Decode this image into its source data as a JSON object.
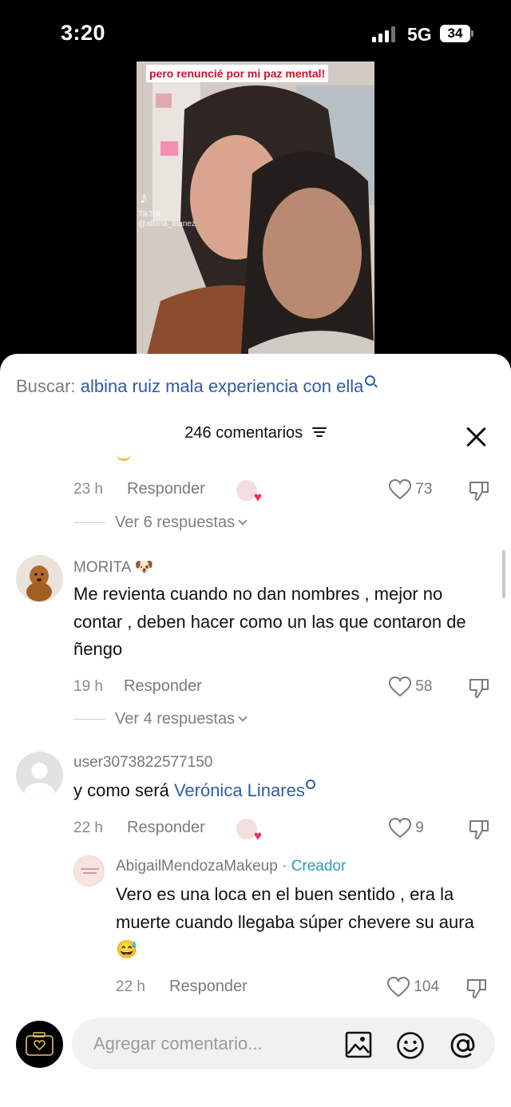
{
  "status_bar": {
    "time": "3:20",
    "network": "5G",
    "battery": "34"
  },
  "video": {
    "caption": "pero renuncié por mi paz mental!",
    "watermark_logo": "♪",
    "watermark_line1": "TikTok",
    "watermark_line2": "@albina_ibanez"
  },
  "search": {
    "label": "Buscar:",
    "query": "albina ruiz mala experiencia con ella"
  },
  "header": {
    "title": "246 comentarios"
  },
  "comments": [
    {
      "time": "23 h",
      "reply": "Responder",
      "likes": "73",
      "view_replies": "Ver 6 respuestas"
    },
    {
      "user": "MORITA",
      "user_emoji": "🐶",
      "text": "Me revienta cuando no dan nombres , mejor no contar , deben hacer como un las que contaron de ñengo",
      "time": "19 h",
      "reply": "Responder",
      "likes": "58",
      "view_replies": "Ver 4 respuestas"
    },
    {
      "user": "user3073822577150",
      "text": "y como será ",
      "mention": "Verónica Linares",
      "time": "22 h",
      "reply": "Responder",
      "likes": "9"
    },
    {
      "user": "AbigailMendozaMakeup",
      "separator": " · ",
      "badge": "Creador",
      "text": "Vero es una loca en el buen sentido , era la muerte cuando llegaba súper chevere su aura 😅",
      "time": "22 h",
      "reply": "Responder",
      "likes": "104"
    }
  ],
  "composer": {
    "placeholder": "Agregar comentario..."
  },
  "icons": [
    "signal-icon",
    "battery-icon",
    "filter-icon",
    "close-icon",
    "search-icon",
    "heart-icon",
    "dislike-icon",
    "chevron-down-icon",
    "camera-icon",
    "image-icon",
    "emoji-icon",
    "mention-icon"
  ],
  "colors": {
    "link": "#2f5ba8",
    "creator": "#2a9bc4",
    "heart_sticker": "#ff2a54",
    "caption": "#d0102a"
  }
}
